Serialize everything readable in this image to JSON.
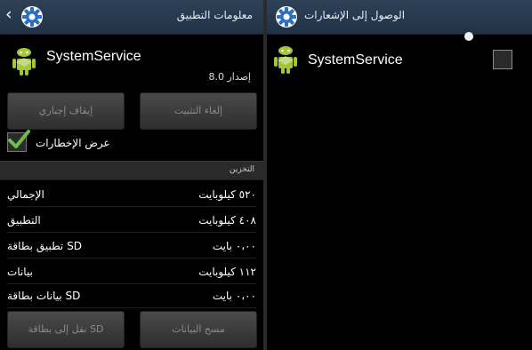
{
  "left": {
    "title": "معلومات التطبيق",
    "app_name": "SystemService",
    "version": "إصدار 8.0",
    "force_stop": "إيقاف إجباري",
    "uninstall": "إلغاء التثبيت",
    "show_notifications": "عرض الإخطارات",
    "show_notifications_checked": true,
    "storage_header": "التخزين",
    "storage_rows": [
      {
        "label": "الإجمالي",
        "value": "٥٢٠ كيلوبايت"
      },
      {
        "label": "التطبيق",
        "value": "٤٠٨ كيلوبايت"
      },
      {
        "label": "تطبيق بطاقة SD",
        "value": "٠،٠٠ بايت"
      },
      {
        "label": "بيانات",
        "value": "١١٢ كيلوبايت"
      },
      {
        "label": "بيانات بطاقة SD",
        "value": "٠،٠٠ بايت"
      }
    ],
    "clear_data": "مسح البيانات",
    "move_to_sd": "نقل إلى بطاقة SD"
  },
  "right": {
    "title": "الوصول إلى الإشعارات",
    "app_name": "SystemService",
    "checked": false
  },
  "colors": {
    "action_bar": "#2a3b50",
    "check_green": "#6cc04a",
    "android_green": "#a4c639"
  },
  "icons": [
    "back-arrow-icon",
    "settings-gear-icon",
    "android-app-icon",
    "checkmark-icon"
  ]
}
